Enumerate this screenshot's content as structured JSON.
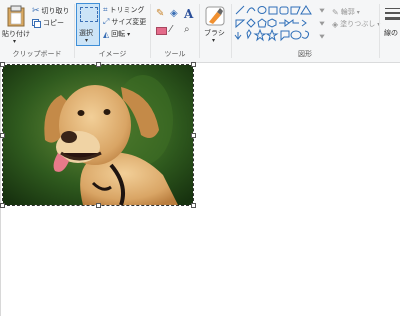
{
  "clipboard": {
    "paste": "貼り付け",
    "cut": "切り取り",
    "copy": "コピー",
    "label": "クリップボード"
  },
  "image": {
    "select": "選択",
    "crop": "トリミング",
    "resize": "サイズ変更",
    "rotate": "回転",
    "label": "イメージ"
  },
  "tools": {
    "label": "ツール",
    "text_icon": "A"
  },
  "brushes": {
    "label": "ブラシ"
  },
  "shapes": {
    "outline": "輪郭",
    "fill": "塗りつぶし",
    "label": "図形"
  },
  "size": {
    "label": "線の"
  },
  "canvas": {
    "image_alt": "dog-photo"
  },
  "colors": {
    "select_highlight": "#cce4f7",
    "select_border": "#3f8fd8"
  }
}
